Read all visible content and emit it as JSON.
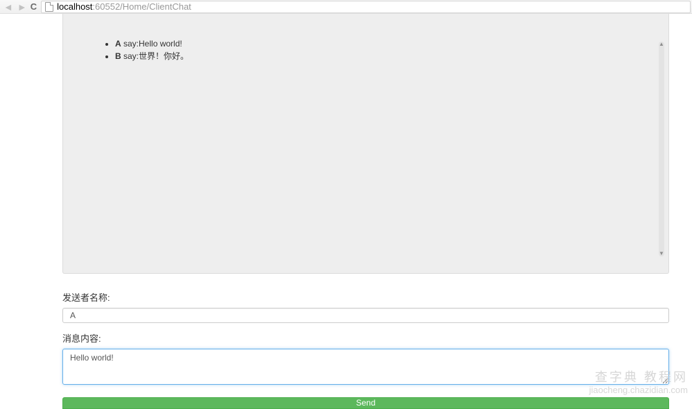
{
  "browser": {
    "url_host": "localhost",
    "url_path": ":60552/Home/ClientChat"
  },
  "chat": {
    "messages": [
      {
        "sender": "A",
        "say_label": " say:",
        "text": "Hello world!"
      },
      {
        "sender": "B",
        "say_label": " say:",
        "text": "世界！你好。"
      }
    ]
  },
  "form": {
    "sender_label": "发送者名称:",
    "sender_value": "A",
    "content_label": "消息内容:",
    "content_value": "Hello world!",
    "send_button": "Send"
  },
  "watermark": {
    "line1": "查字典 教程网",
    "line2": "jiaocheng.chazidian.com"
  }
}
